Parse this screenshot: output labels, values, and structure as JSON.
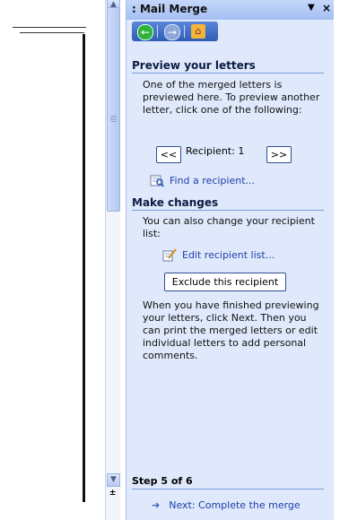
{
  "pane": {
    "title": ": Mail Merge",
    "dropdown_icon": "▼",
    "close_icon": "×"
  },
  "nav": {
    "back": "←",
    "forward": "→",
    "home": "⌂"
  },
  "preview": {
    "heading": "Preview your letters",
    "intro": "One of the merged letters is previewed here. To preview another letter, click one of the following:",
    "prev_button": "<<",
    "recipient_label": "Recipient: 1",
    "next_button": ">>",
    "find_link": "Find a recipient..."
  },
  "changes": {
    "heading": "Make changes",
    "intro": "You can also change your recipient list:",
    "edit_link": "Edit recipient list...",
    "exclude_button": "Exclude this recipient",
    "finish_text": "When you have finished previewing your letters, click Next. Then you can print the merged letters or edit individual letters to add personal comments."
  },
  "footer": {
    "step": "Step 5 of 6",
    "next_link": "Next: Complete the merge"
  }
}
